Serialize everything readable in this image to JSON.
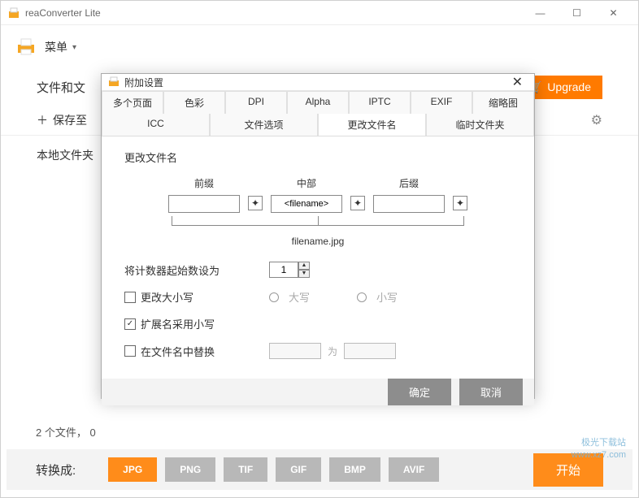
{
  "app": {
    "title": "reaConverter Lite",
    "menu_label": "菜单"
  },
  "colors": {
    "accent": "#ff8c1a",
    "button_gray": "#b8b8b8"
  },
  "main": {
    "files_label": "文件和文",
    "upgrade_label": "Upgrade",
    "save_to_label": "保存至",
    "local_folder_label": "本地文件夹",
    "status_text": "2 个文件， 0",
    "convert_label": "转换成:",
    "formats": [
      "JPG",
      "PNG",
      "TIF",
      "GIF",
      "BMP",
      "AVIF"
    ],
    "active_format": "JPG",
    "start_label": "开始"
  },
  "watermark": {
    "line1": "极光下载站",
    "line2": "www.xz7.com"
  },
  "dialog": {
    "title": "附加设置",
    "tabs_row1": [
      "多个页面",
      "色彩",
      "DPI",
      "Alpha",
      "IPTC",
      "EXIF",
      "缩略图"
    ],
    "tabs_row2": [
      "ICC",
      "文件选项",
      "更改文件名",
      "临时文件夹"
    ],
    "active_tab": "更改文件名",
    "section_title": "更改文件名",
    "name_parts": {
      "prefix_label": "前缀",
      "middle_label": "中部",
      "suffix_label": "后缀",
      "prefix_value": "",
      "middle_value": "<filename>",
      "suffix_value": ""
    },
    "preview": "filename.jpg",
    "counter_label": "将计数器起始数设为",
    "counter_value": "1",
    "change_case_label": "更改大小写",
    "change_case_checked": false,
    "uppercase_label": "大写",
    "lowercase_label": "小写",
    "ext_lowercase_label": "扩展名采用小写",
    "ext_lowercase_checked": true,
    "replace_label": "在文件名中替换",
    "replace_checked": false,
    "replace_from": "",
    "replace_with_label": "为",
    "replace_to": "",
    "ok_label": "确定",
    "cancel_label": "取消"
  }
}
